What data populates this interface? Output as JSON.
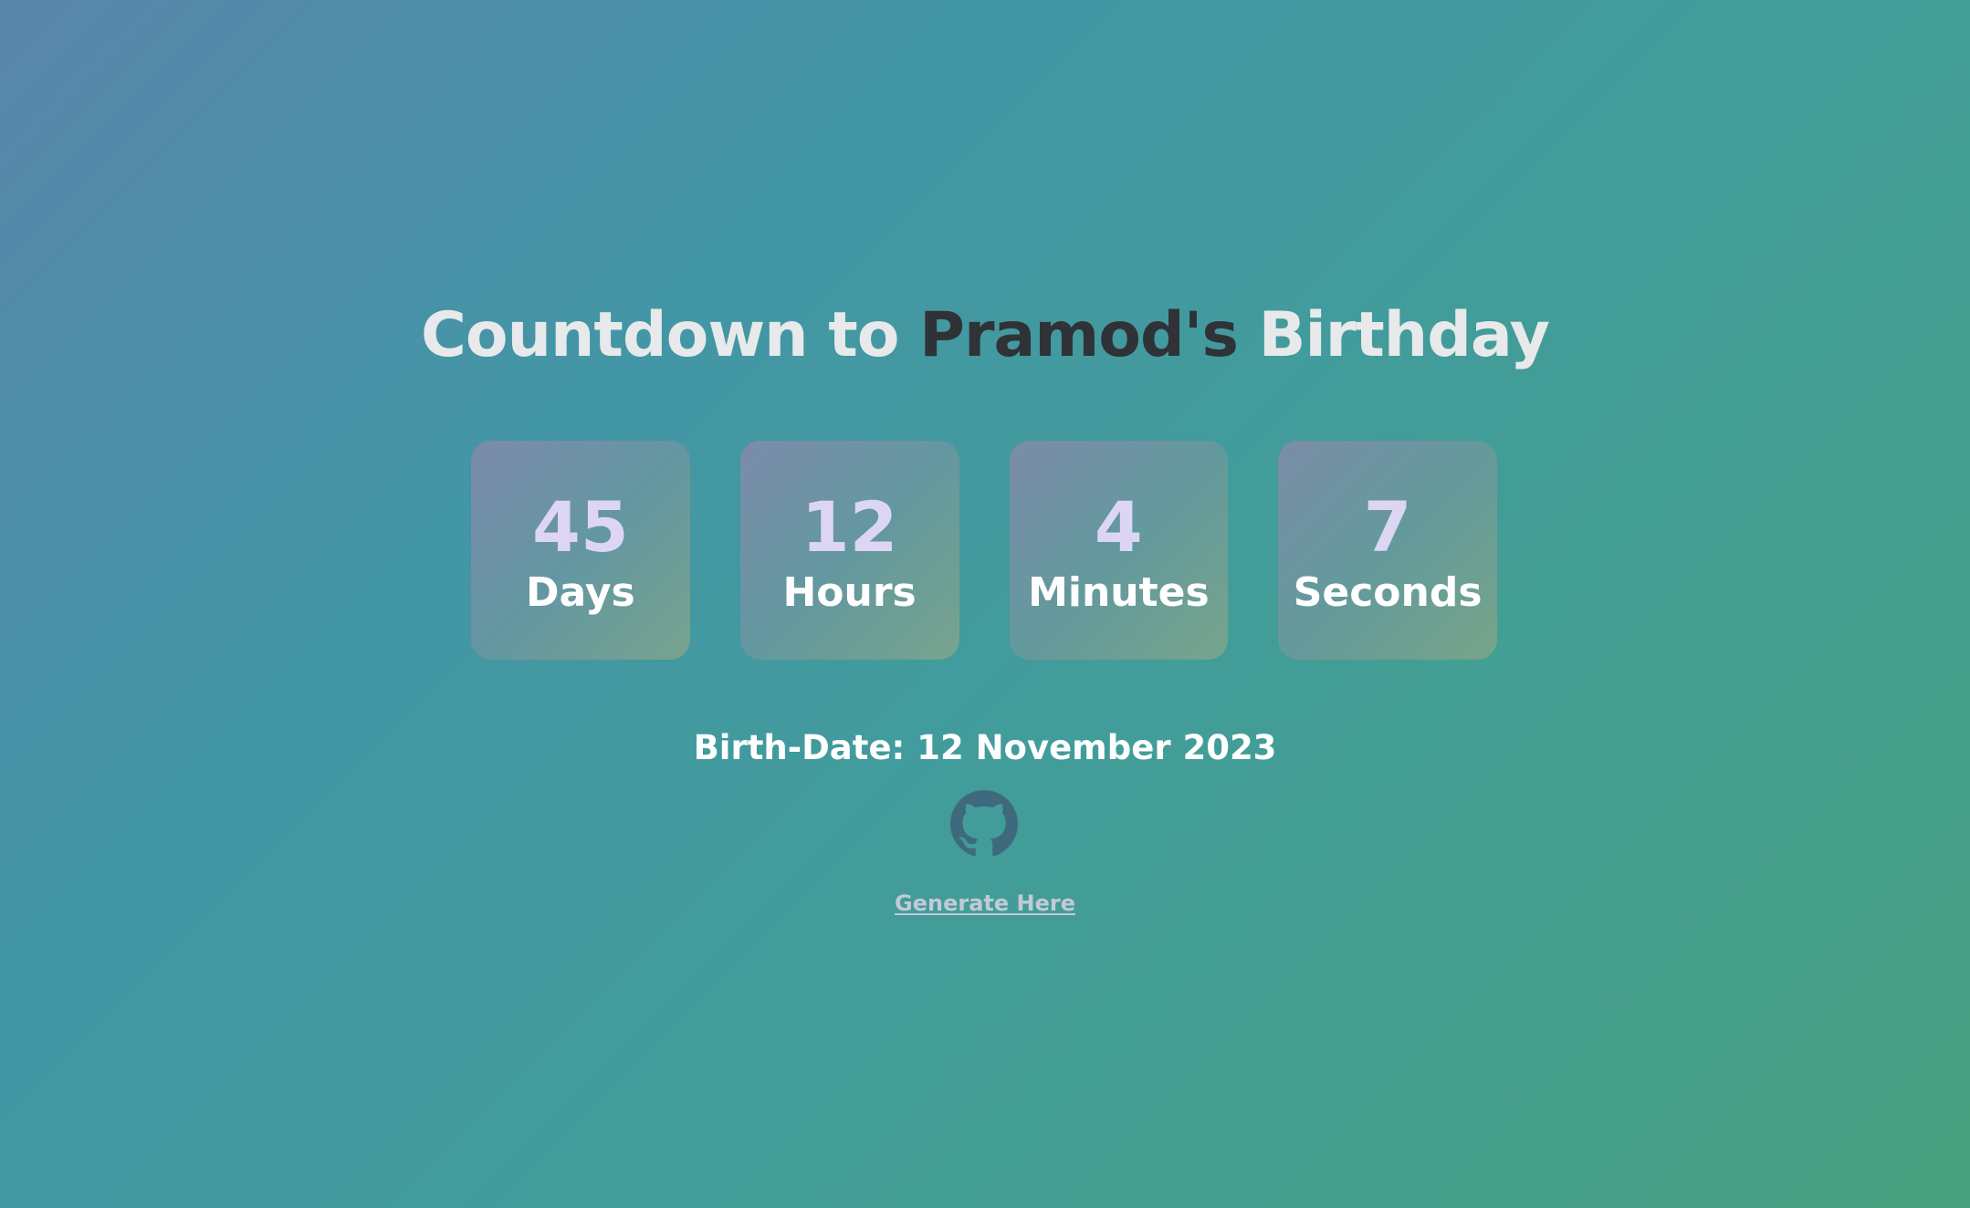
{
  "title": {
    "prefix": "Countdown to ",
    "name": "Pramod's",
    "suffix": " Birthday"
  },
  "countdown": [
    {
      "value": "45",
      "label": "Days"
    },
    {
      "value": "12",
      "label": "Hours"
    },
    {
      "value": "4",
      "label": "Minutes"
    },
    {
      "value": "7",
      "label": "Seconds"
    }
  ],
  "birth_date": "Birth-Date: 12 November 2023",
  "github": {
    "icon": "github-icon"
  },
  "generate_link": "Generate Here",
  "colors": {
    "name_accent": "#2f3236",
    "title_text": "#e7e9ea",
    "countdown_value": "#dcd6f4",
    "github_icon": "#3f6a7d",
    "link": "#c3cad6"
  }
}
